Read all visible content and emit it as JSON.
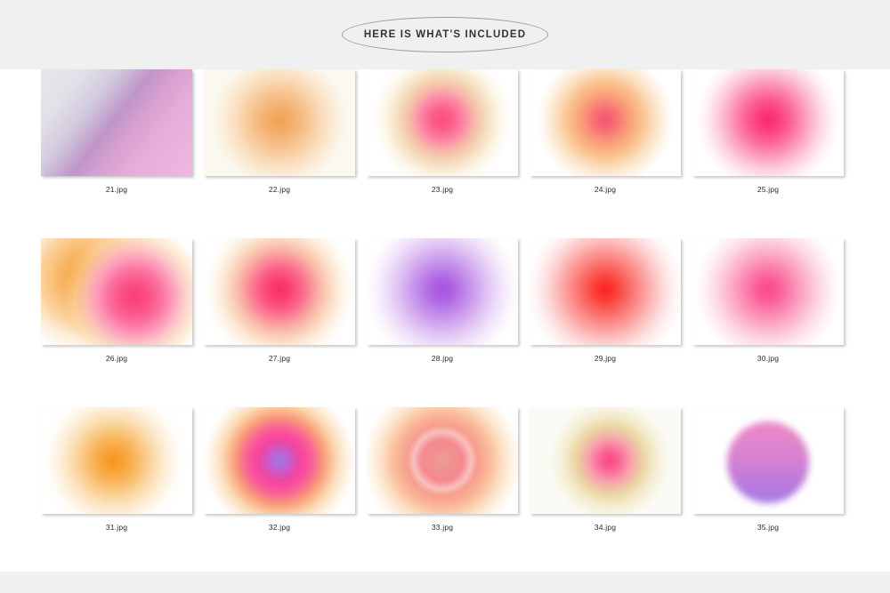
{
  "header": {
    "badge_text": "HERE IS WHAT'S INCLUDED",
    "band_color": "#f0f0f0",
    "badge_border_color": "#9a9a9a",
    "text_color": "#333333"
  },
  "content": {
    "background": "#ffffff"
  },
  "footer": {
    "band_color": "#f0f0f0"
  },
  "gallery": {
    "columns": 5,
    "rows": 3,
    "items": [
      {
        "label": "21.jpg",
        "kind": "linear-gradient",
        "description": "Diagonal gradient from pale grey to purple band to soft pink",
        "background": "#e2e2e6",
        "colors": [
          "#e3e3e7",
          "#d8d6e0",
          "#b98ec4",
          "#e8a9d2",
          "#eeb6de"
        ]
      },
      {
        "label": "22.jpg",
        "kind": "radial-blur",
        "description": "Soft orange blurred circle on cream background",
        "background": "#fbf8ef",
        "colors": [
          "#f0a153",
          "#f6c28e",
          "#faddbe",
          "#fbf8ef"
        ]
      },
      {
        "label": "23.jpg",
        "kind": "radial-blur",
        "description": "Pink core with pale yellow halo on white",
        "background": "#ffffff",
        "colors": [
          "#fb4e7f",
          "#fb85a5",
          "#f4d9b8",
          "#fbf4e4",
          "#ffffff"
        ]
      },
      {
        "label": "24.jpg",
        "kind": "radial-blur",
        "description": "Pink-red core with orange ring fading to white",
        "background": "#ffffff",
        "colors": [
          "#f75574",
          "#f98d7a",
          "#f8b87f",
          "#fbdcbb",
          "#ffffff"
        ]
      },
      {
        "label": "25.jpg",
        "kind": "radial-blur",
        "description": "Vivid hot pink blurred circle on white",
        "background": "#ffffff",
        "colors": [
          "#fb2a6e",
          "#fb5c93",
          "#fc9dbd",
          "#fdd6e3",
          "#ffffff"
        ]
      },
      {
        "label": "26.jpg",
        "kind": "radial-blur-double",
        "description": "Small orange circle overlapping a larger pink circle",
        "background": "#ffffff",
        "colors": [
          "#f59a2d",
          "#f9c07a",
          "#fb3e78",
          "#fc84a8",
          "#ffffff"
        ]
      },
      {
        "label": "27.jpg",
        "kind": "radial-blur",
        "description": "Deep pink circle with warm cream halo",
        "background": "#ffffff",
        "colors": [
          "#fb2e63",
          "#fb6a90",
          "#f9b6a8",
          "#fae0c8",
          "#ffffff"
        ]
      },
      {
        "label": "28.jpg",
        "kind": "radial-blur",
        "description": "Purple violet blurred circle on white",
        "background": "#ffffff",
        "colors": [
          "#a855e0",
          "#bd82e8",
          "#d6b1f0",
          "#efe0f8",
          "#ffffff"
        ]
      },
      {
        "label": "29.jpg",
        "kind": "radial-blur",
        "description": "Bright red blurred circle on white",
        "background": "#ffffff",
        "colors": [
          "#fb2424",
          "#fa5c56",
          "#fb9190",
          "#fdcdcd",
          "#ffffff"
        ]
      },
      {
        "label": "30.jpg",
        "kind": "radial-blur",
        "description": "Soft medium pink blurred circle on white",
        "background": "#ffffff",
        "colors": [
          "#fb4a8c",
          "#fa7ba8",
          "#fcaac7",
          "#fddfe9",
          "#ffffff"
        ]
      },
      {
        "label": "31.jpg",
        "kind": "radial-blur",
        "description": "Orange blurred circle on white",
        "background": "#ffffff",
        "colors": [
          "#f7951c",
          "#f8b055",
          "#fbcd93",
          "#fde9d1",
          "#ffffff"
        ]
      },
      {
        "label": "32.jpg",
        "kind": "radial-blur",
        "description": "Violet-blue core through magenta to orange rim",
        "background": "#ffffff",
        "colors": [
          "#9a7be0",
          "#e04fc0",
          "#fb4f9e",
          "#f89a6a",
          "#fbd9b7",
          "#ffffff"
        ]
      },
      {
        "label": "33.jpg",
        "kind": "radial-blur",
        "description": "Coral salmon pink circle with peach rim",
        "background": "#ffffff",
        "colors": [
          "#f0908f",
          "#f4898f",
          "#f79e8e",
          "#fac3a0",
          "#fce4cf",
          "#ffffff"
        ]
      },
      {
        "label": "34.jpg",
        "kind": "radial-blur",
        "description": "Small pink core with pale khaki halo on off-white",
        "background": "#fbfbf6",
        "colors": [
          "#fb4a86",
          "#fa86a5",
          "#eed9a6",
          "#f5f1df",
          "#fbfbf6"
        ]
      },
      {
        "label": "35.jpg",
        "kind": "hard-circle-gradient",
        "description": "Hard edged circle with pink to purple vertical gradient",
        "background": "#ffffff",
        "colors": [
          "#e887c8",
          "#d982cd",
          "#bb7cd9",
          "#a87ae2"
        ]
      }
    ]
  }
}
